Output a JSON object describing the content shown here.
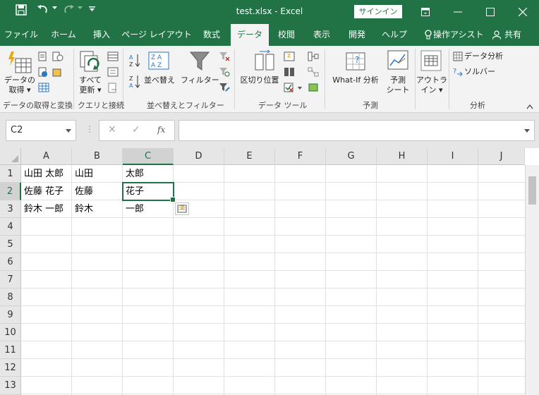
{
  "window": {
    "title": "test.xlsx  -  Excel",
    "signin": "サインイン"
  },
  "tabs": [
    {
      "label": "ファイル"
    },
    {
      "label": "ホーム"
    },
    {
      "label": "挿入"
    },
    {
      "label": "ページ レイアウト"
    },
    {
      "label": "数式"
    },
    {
      "label": "データ"
    },
    {
      "label": "校閲"
    },
    {
      "label": "表示"
    },
    {
      "label": "開発"
    },
    {
      "label": "ヘルプ"
    },
    {
      "label": "操作アシスト"
    },
    {
      "label": "共有"
    }
  ],
  "ribbon": {
    "get_data_line1": "データの",
    "get_data_line2": "取得",
    "refresh_line1": "すべて",
    "refresh_line2": "更新",
    "sort": "並べ替え",
    "filter": "フィルター",
    "text_to_columns": "区切り位置",
    "whatif": "What-If 分析",
    "forecast_line1": "予測",
    "forecast_line2": "シート",
    "outline_line1": "アウトラ",
    "outline_line2": "イン",
    "data_analysis": "データ分析",
    "solver": "ソルバー",
    "groups": {
      "get_transform": "データの取得と変換",
      "queries": "クエリと接続",
      "sort_filter": "並べ替えとフィルター",
      "data_tools": "データ ツール",
      "forecast": "予測",
      "analysis": "分析"
    }
  },
  "formula_bar": {
    "name_box": "C2",
    "fx": "fx",
    "formula": ""
  },
  "sheet": {
    "columns": [
      "A",
      "B",
      "C",
      "D",
      "E",
      "F",
      "G",
      "H",
      "I",
      "J"
    ],
    "rows": [
      "1",
      "2",
      "3",
      "4",
      "5",
      "6",
      "7",
      "8",
      "9",
      "10",
      "11",
      "12",
      "13"
    ],
    "cells": {
      "A1": "山田 太郎",
      "B1": "山田",
      "C1": "太郎",
      "A2": "佐藤 花子",
      "B2": "佐藤",
      "C2": "花子",
      "A3": "鈴木 一郎",
      "B3": "鈴木",
      "C3": "一郎"
    },
    "selected_cell": "C2"
  }
}
